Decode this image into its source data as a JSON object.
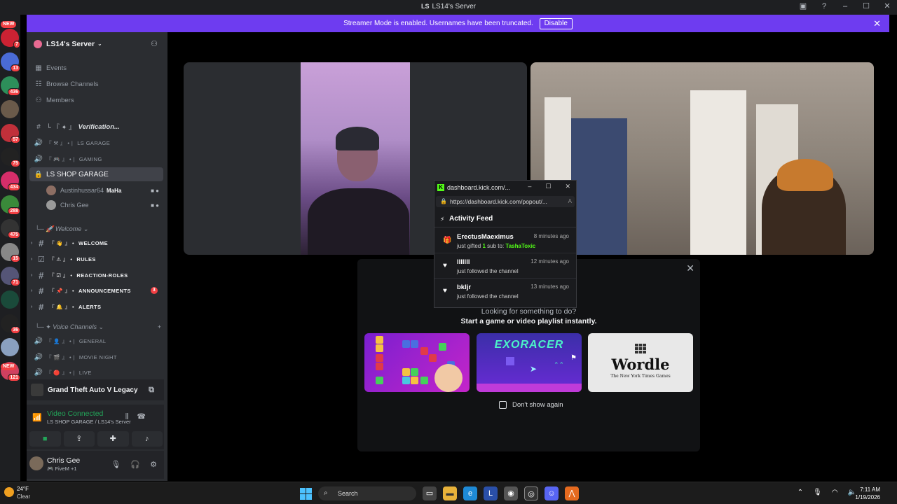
{
  "window": {
    "title": "LS14's Server"
  },
  "banner": {
    "message": "Streamer Mode is enabled. Usernames have been truncated.",
    "disable_label": "Disable"
  },
  "server_rail": {
    "badges": [
      "NEW",
      "7",
      "13",
      "436",
      "57",
      "75",
      "434",
      "288",
      "475",
      "15",
      "71",
      "36",
      "121",
      "NEW"
    ]
  },
  "guild": {
    "name": "LS14's Server"
  },
  "nav": {
    "events": "Events",
    "browse": "Browse Channels",
    "members": "Members"
  },
  "channels": {
    "verification": "Verification...",
    "ls_garage": "LS GARAGE",
    "gaming": "GAMING",
    "ls_shop_garage": "LS SHOP GARAGE",
    "user1": "Austinhussar64",
    "user1_tag": "MaHa",
    "user2": "Chris Gee",
    "welcome_cat": "Welcome",
    "welcome": "WELCOME",
    "rules": "RULES",
    "reaction_roles": "REACTION-ROLES",
    "announcements": "ANNOUNCEMENTS",
    "announcements_mentions": "3",
    "alerts": "ALERTS",
    "voice_cat": "Voice Channels",
    "general": "GENERAL",
    "movie_night": "MOVIE NIGHT",
    "live": "LIVE"
  },
  "activity": {
    "game": "Grand Theft Auto V Legacy"
  },
  "voice": {
    "status": "Video Connected",
    "location": "LS SHOP GARAGE / LS14's Server"
  },
  "user": {
    "name": "Chris Gee",
    "status": "FiveM +1"
  },
  "popout": {
    "title": "dashboard.kick.com/...",
    "url": "https://dashboard.kick.com/popout/...",
    "feed_title": "Activity Feed",
    "entries": [
      {
        "name": "ErectusMaeximus",
        "time": "8 minutes ago",
        "desc_pre": "just gifted",
        "count": "1",
        "desc_mid": "sub to:",
        "target": "TashaToxic"
      },
      {
        "name": "lllllll",
        "time": "12 minutes ago",
        "desc": "just followed the channel"
      },
      {
        "name": "bkljr",
        "time": "13 minutes ago",
        "desc": "just followed the channel"
      }
    ]
  },
  "modal": {
    "line1": "Looking for something to do?",
    "line2": "Start a game or video playlist instantly.",
    "tile2_logo": "EXORACER",
    "tile3_title": "Wordle",
    "tile3_sub": "The New York Times Games",
    "checkbox": "Don't show again"
  },
  "taskbar": {
    "temp": "24°F",
    "condition": "Clear",
    "search": "Search",
    "time": "7:11 AM",
    "date": "1/19/2026"
  }
}
